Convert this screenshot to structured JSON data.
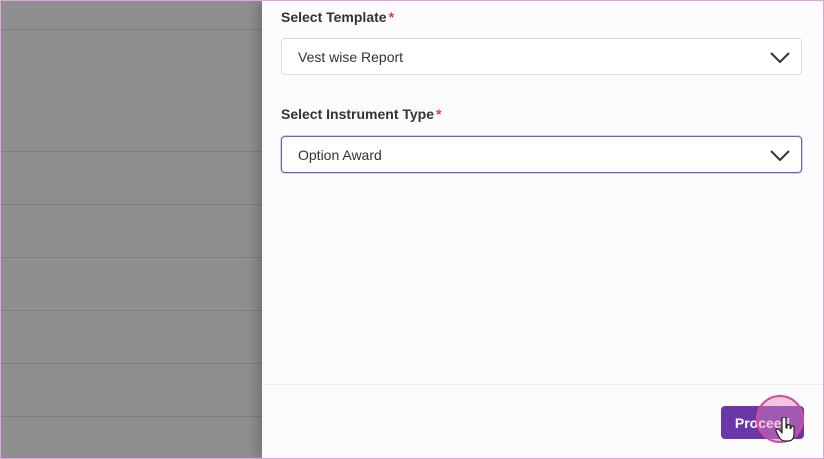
{
  "form": {
    "template_label": "Select Template",
    "template_required": "*",
    "template_value": "Vest wise Report",
    "instrument_label": "Select Instrument Type",
    "instrument_required": "*",
    "instrument_value": "Option Award"
  },
  "footer": {
    "proceed_label": "Proceed"
  },
  "icons": {
    "dropdown": "chevron-down-icon",
    "cursor": "hand-pointer-icon"
  },
  "colors": {
    "accent": "#6a37a8",
    "required": "#d63b50",
    "backdrop": "#8f8f8f"
  }
}
